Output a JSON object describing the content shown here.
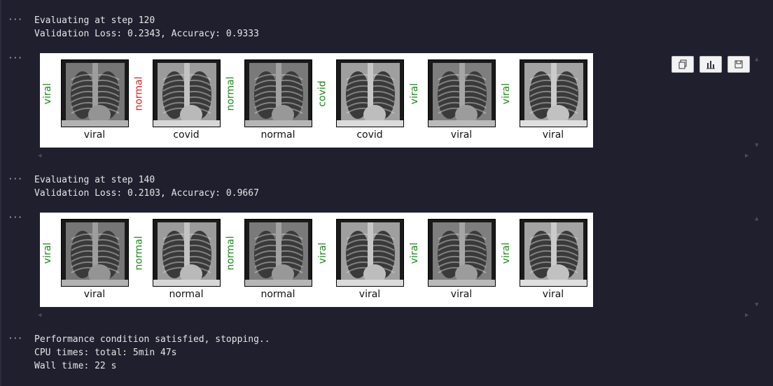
{
  "colors": {
    "correct": "#1a8a1a",
    "wrong": "#e01b1b",
    "background": "#1f1f2e"
  },
  "outputs": {
    "eval1": {
      "line1": "Evaluating at step 120",
      "line2": "Validation Loss: 0.2343, Accuracy: 0.9333"
    },
    "eval2": {
      "line1": "Evaluating at step 140",
      "line2": "Validation Loss: 0.2103, Accuracy: 0.9667"
    },
    "final": {
      "line1": "Performance condition satisfied, stopping..",
      "line2": "CPU times: total: 5min 47s",
      "line3": "Wall time: 22 s"
    }
  },
  "figure1": {
    "panels": [
      {
        "pred": "viral",
        "actual": "viral",
        "correct": true
      },
      {
        "pred": "normal",
        "actual": "covid",
        "correct": false
      },
      {
        "pred": "normal",
        "actual": "normal",
        "correct": true
      },
      {
        "pred": "covid",
        "actual": "covid",
        "correct": true
      },
      {
        "pred": "viral",
        "actual": "viral",
        "correct": true
      },
      {
        "pred": "viral",
        "actual": "viral",
        "correct": true
      }
    ]
  },
  "figure2": {
    "panels": [
      {
        "pred": "viral",
        "actual": "viral",
        "correct": true
      },
      {
        "pred": "normal",
        "actual": "normal",
        "correct": true
      },
      {
        "pred": "normal",
        "actual": "normal",
        "correct": true
      },
      {
        "pred": "viral",
        "actual": "viral",
        "correct": true
      },
      {
        "pred": "viral",
        "actual": "viral",
        "correct": true
      },
      {
        "pred": "viral",
        "actual": "viral",
        "correct": true
      }
    ]
  },
  "toolbar": {
    "icons": [
      "copy-icon",
      "chart-icon",
      "save-icon"
    ]
  },
  "ellipsis": "···"
}
